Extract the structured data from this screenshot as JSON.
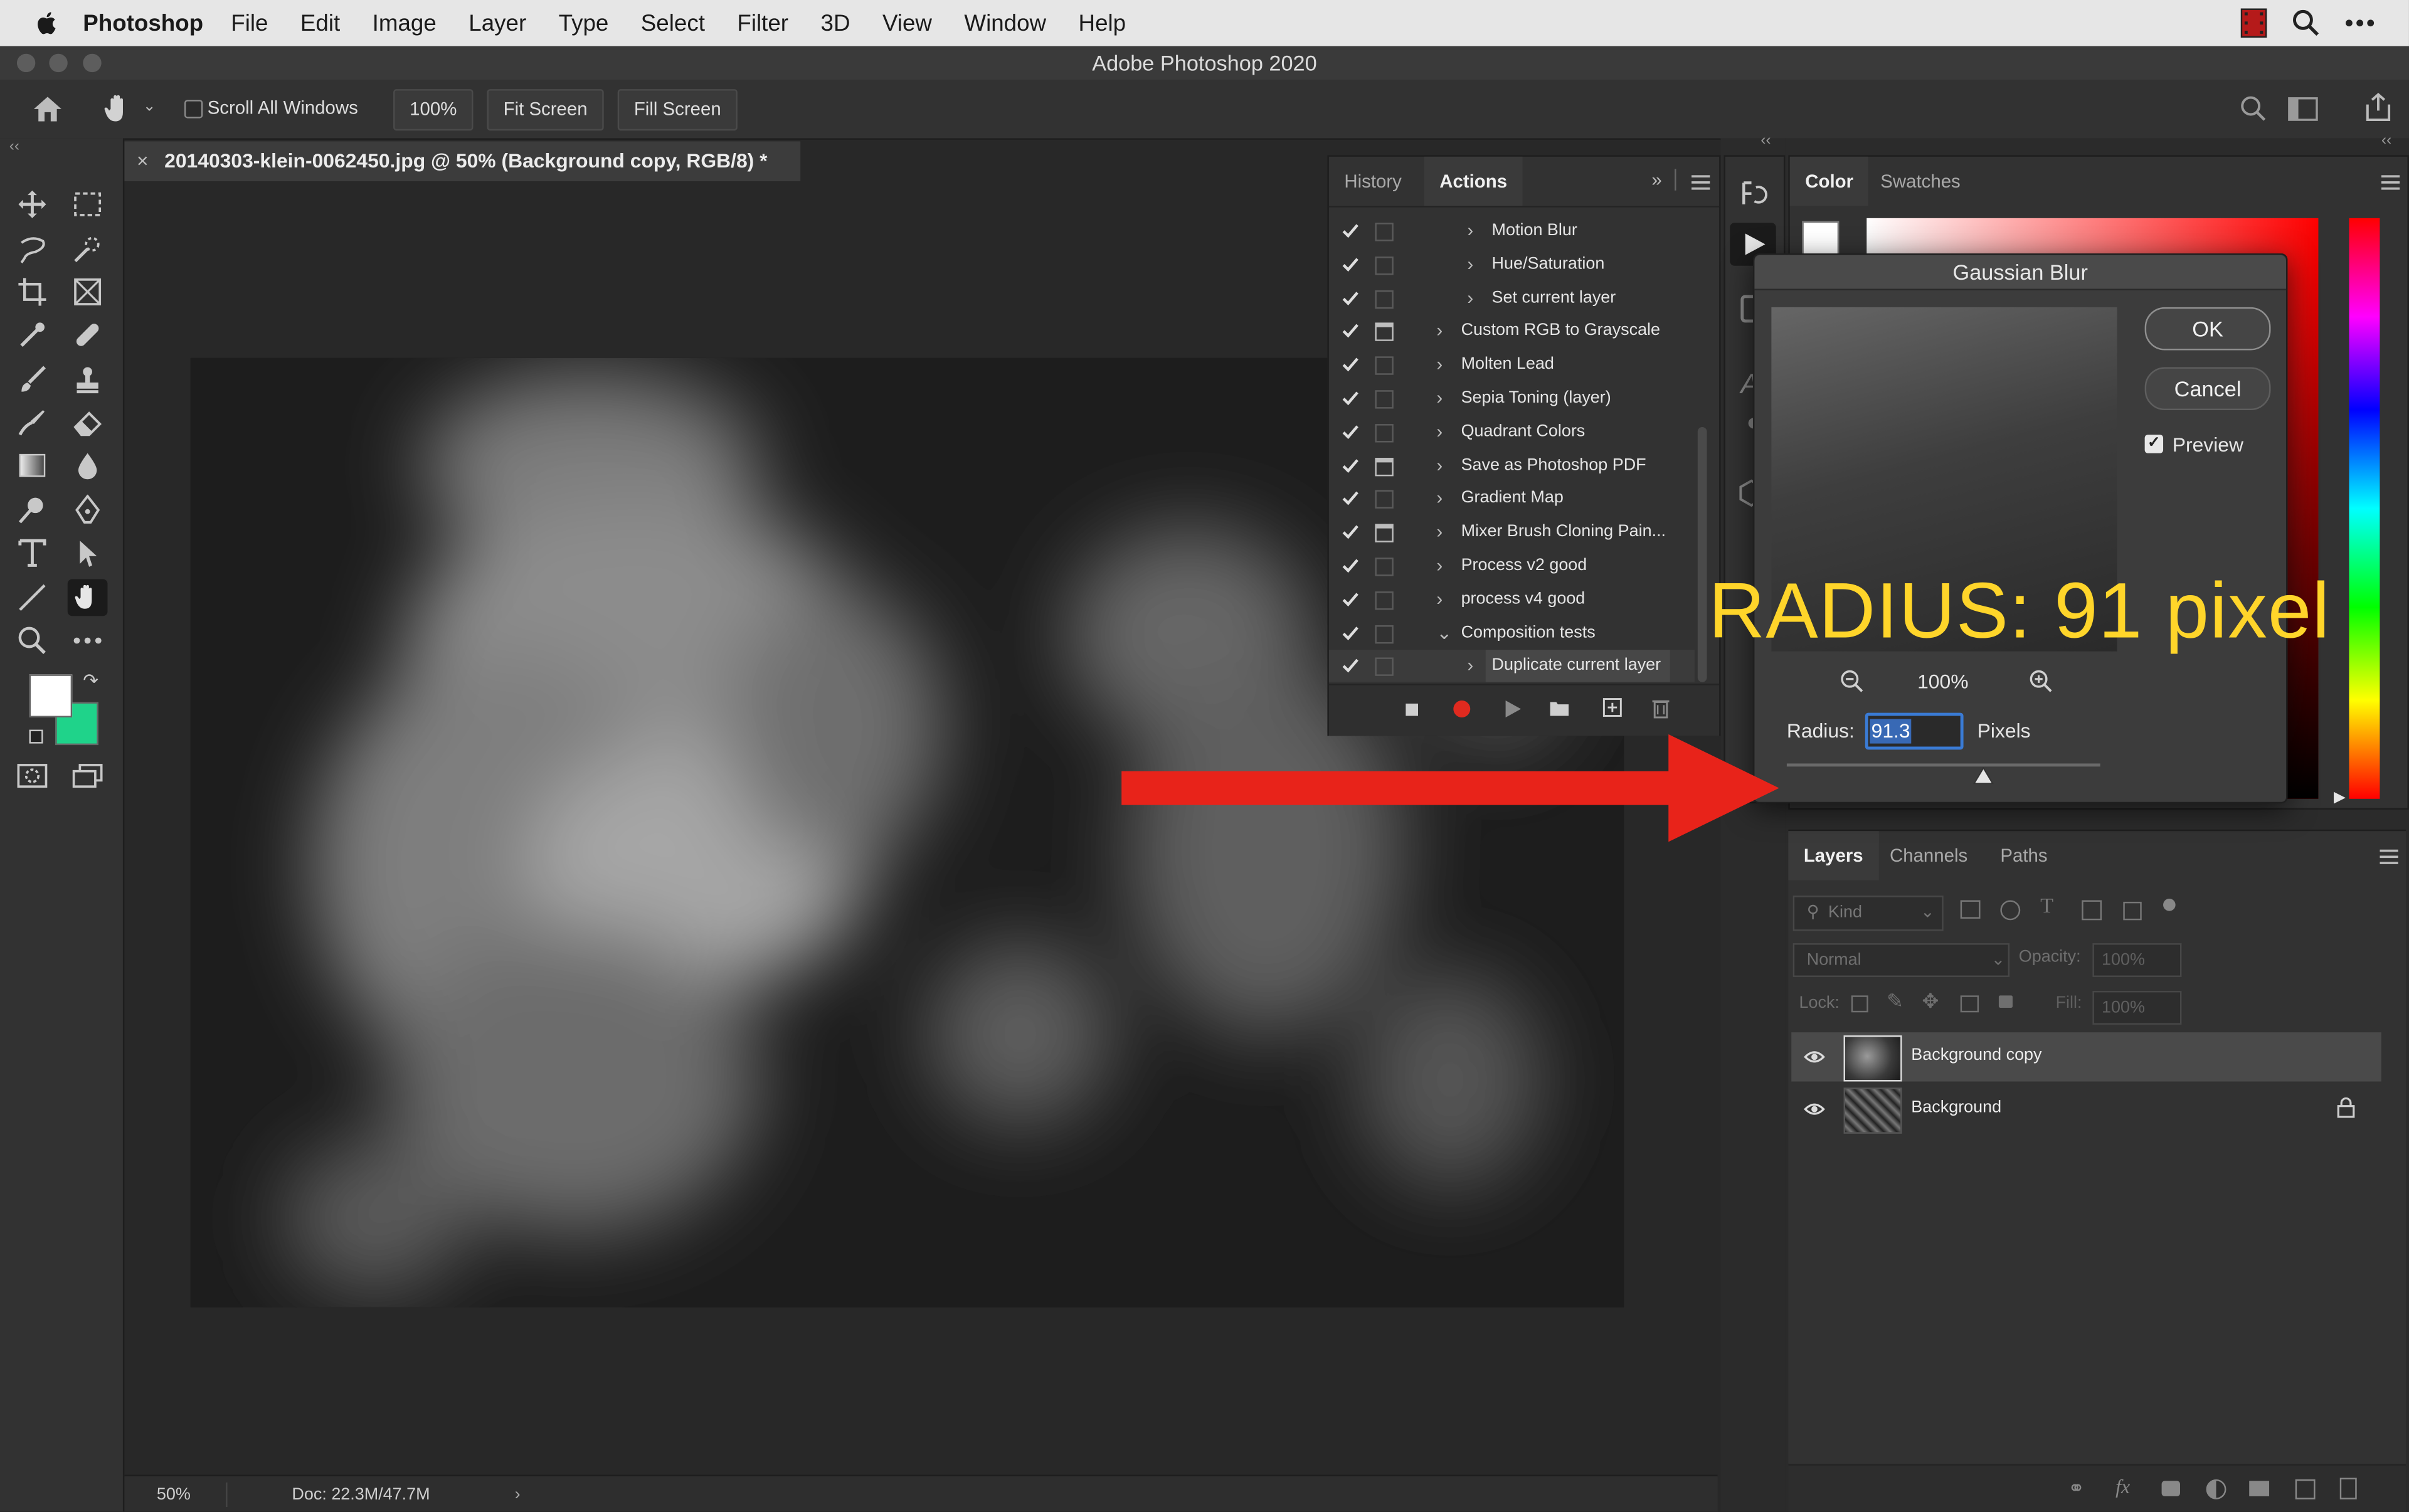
{
  "menubar": {
    "app_name": "Photoshop",
    "items": [
      "File",
      "Edit",
      "Image",
      "Layer",
      "Type",
      "Select",
      "Filter",
      "3D",
      "View",
      "Window",
      "Help"
    ]
  },
  "window": {
    "title": "Adobe Photoshop 2020"
  },
  "options_bar": {
    "scroll_all_windows": "Scroll All Windows",
    "zoom_value": "100%",
    "fit_screen": "Fit Screen",
    "fill_screen": "Fill Screen"
  },
  "document": {
    "tab_title": "20140303-klein-0062450.jpg @ 50% (Background copy, RGB/8) *",
    "zoom": "50%",
    "doc_info": "Doc: 22.3M/47.7M"
  },
  "actions_panel": {
    "tabs": [
      "History",
      "Actions"
    ],
    "active_tab": "Actions",
    "items": [
      {
        "label": "Motion Blur",
        "level": 2,
        "dialog": false,
        "expanded": false
      },
      {
        "label": "Hue/Saturation",
        "level": 2,
        "dialog": false,
        "expanded": false
      },
      {
        "label": "Set current layer",
        "level": 2,
        "dialog": false,
        "expanded": false
      },
      {
        "label": "Custom RGB to Grayscale",
        "level": 1,
        "dialog": true,
        "expanded": false
      },
      {
        "label": "Molten Lead",
        "level": 1,
        "dialog": false,
        "expanded": false
      },
      {
        "label": "Sepia Toning (layer)",
        "level": 1,
        "dialog": false,
        "expanded": false
      },
      {
        "label": "Quadrant Colors",
        "level": 1,
        "dialog": false,
        "expanded": false
      },
      {
        "label": "Save as Photoshop PDF",
        "level": 1,
        "dialog": true,
        "expanded": false
      },
      {
        "label": "Gradient Map",
        "level": 1,
        "dialog": false,
        "expanded": false
      },
      {
        "label": "Mixer Brush Cloning Pain...",
        "level": 1,
        "dialog": true,
        "expanded": false
      },
      {
        "label": "Process v2 good",
        "level": 1,
        "dialog": false,
        "expanded": false
      },
      {
        "label": "process v4 good",
        "level": 1,
        "dialog": false,
        "expanded": false
      },
      {
        "label": "Composition tests",
        "level": 1,
        "dialog": false,
        "expanded": true
      },
      {
        "label": "Duplicate current layer",
        "level": 2,
        "dialog": false,
        "expanded": false,
        "selected": true
      }
    ]
  },
  "color_panel": {
    "tabs": [
      "Color",
      "Swatches"
    ],
    "active_tab": "Color"
  },
  "gaussian_blur": {
    "title": "Gaussian Blur",
    "ok": "OK",
    "cancel": "Cancel",
    "preview_label": "Preview",
    "preview_checked": true,
    "zoom": "100%",
    "radius_label": "Radius:",
    "radius_value": "91.3",
    "radius_unit": "Pixels"
  },
  "annotation": {
    "text": "RADIUS: 91 pixel",
    "color": "#ffd52a",
    "arrow_color": "#e8231a"
  },
  "layers_panel": {
    "tabs": [
      "Layers",
      "Channels",
      "Paths"
    ],
    "active_tab": "Layers",
    "kind_placeholder": "Kind",
    "blend_mode": "Normal",
    "opacity_label": "Opacity:",
    "opacity_value": "100%",
    "lock_label": "Lock:",
    "fill_label": "Fill:",
    "fill_value": "100%",
    "layers": [
      {
        "name": "Background copy",
        "visible": true,
        "selected": true,
        "locked": false
      },
      {
        "name": "Background",
        "visible": true,
        "selected": false,
        "locked": true
      }
    ]
  },
  "colors": {
    "foreground": "#ffffff",
    "background": "#1fd38a"
  }
}
